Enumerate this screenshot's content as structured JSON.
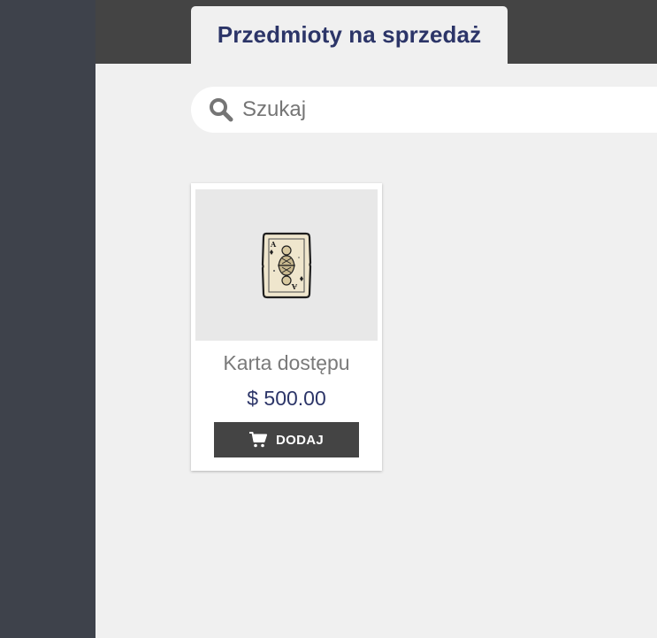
{
  "header": {
    "active_tab_label": "Przedmioty na sprzedaż"
  },
  "search": {
    "placeholder": "Szukaj",
    "value": "",
    "icon": "search-icon"
  },
  "products": [
    {
      "name": "Karta dostępu",
      "price": "$ 500.00",
      "image_icon": "playing-card-icon",
      "button_label": "DODAJ",
      "button_icon": "cart-icon"
    }
  ],
  "colors": {
    "sidebar": "#3e424b",
    "topbar": "#444444",
    "background": "#f0f0f0",
    "accent_text": "#2c3568",
    "button": "#444444"
  }
}
